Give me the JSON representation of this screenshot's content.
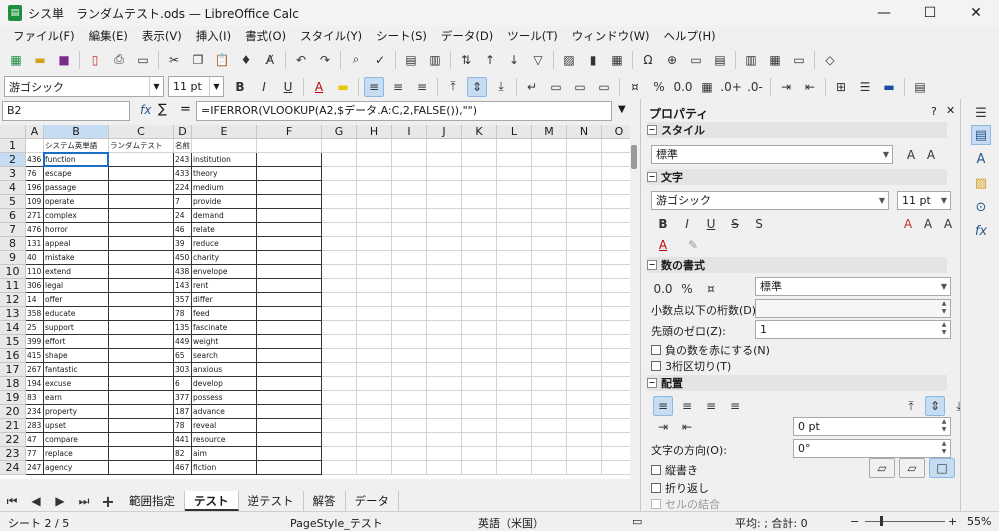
{
  "window": {
    "title": "シス単　ランダムテスト.ods — LibreOffice Calc",
    "app_icon": "calc-icon"
  },
  "menu": [
    "ファイル(F)",
    "編集(E)",
    "表示(V)",
    "挿入(I)",
    "書式(O)",
    "スタイル(Y)",
    "シート(S)",
    "データ(D)",
    "ツール(T)",
    "ウィンドウ(W)",
    "ヘルプ(H)"
  ],
  "format": {
    "font": "游ゴシック",
    "size": "11 pt"
  },
  "formula_bar": {
    "cell": "B2",
    "formula": "=IFERROR(VLOOKUP(A2,$データ.A:C,2,FALSE()),\"\")",
    "fx": "fx",
    "sigma": "∑",
    "eq": "="
  },
  "columns": [
    "A",
    "B",
    "C",
    "D",
    "E",
    "F",
    "G",
    "H",
    "I",
    "J",
    "K",
    "L",
    "M",
    "N",
    "O"
  ],
  "header_row": {
    "b": "システム英単語",
    "c": "ランダムテスト",
    "d": "名前："
  },
  "rows": [
    {
      "n": "2",
      "a": "436",
      "b": "function",
      "d": "243",
      "e": "institution"
    },
    {
      "n": "3",
      "a": "76",
      "b": "escape",
      "d": "433",
      "e": "theory"
    },
    {
      "n": "4",
      "a": "196",
      "b": "passage",
      "d": "224",
      "e": "medium"
    },
    {
      "n": "5",
      "a": "109",
      "b": "operate",
      "d": "7",
      "e": "provide"
    },
    {
      "n": "6",
      "a": "271",
      "b": "complex",
      "d": "24",
      "e": "demand"
    },
    {
      "n": "7",
      "a": "476",
      "b": "horror",
      "d": "46",
      "e": "relate"
    },
    {
      "n": "8",
      "a": "131",
      "b": "appeal",
      "d": "39",
      "e": "reduce"
    },
    {
      "n": "9",
      "a": "40",
      "b": "mistake",
      "d": "450",
      "e": "charity"
    },
    {
      "n": "10",
      "a": "110",
      "b": "extend",
      "d": "438",
      "e": "envelope"
    },
    {
      "n": "11",
      "a": "306",
      "b": "legal",
      "d": "143",
      "e": "rent"
    },
    {
      "n": "12",
      "a": "14",
      "b": "offer",
      "d": "357",
      "e": "differ"
    },
    {
      "n": "13",
      "a": "358",
      "b": "educate",
      "d": "78",
      "e": "feed"
    },
    {
      "n": "14",
      "a": "25",
      "b": "support",
      "d": "135",
      "e": "fascinate"
    },
    {
      "n": "15",
      "a": "399",
      "b": "effort",
      "d": "449",
      "e": "weight"
    },
    {
      "n": "16",
      "a": "415",
      "b": "shape",
      "d": "65",
      "e": "search"
    },
    {
      "n": "17",
      "a": "267",
      "b": "fantastic",
      "d": "303",
      "e": "anxious"
    },
    {
      "n": "18",
      "a": "194",
      "b": "excuse",
      "d": "6",
      "e": "develop"
    },
    {
      "n": "19",
      "a": "83",
      "b": "earn",
      "d": "377",
      "e": "possess"
    },
    {
      "n": "20",
      "a": "234",
      "b": "property",
      "d": "187",
      "e": "advance"
    },
    {
      "n": "21",
      "a": "283",
      "b": "upset",
      "d": "78",
      "e": "reveal"
    },
    {
      "n": "22",
      "a": "47",
      "b": "compare",
      "d": "441",
      "e": "resource"
    },
    {
      "n": "23",
      "a": "77",
      "b": "replace",
      "d": "82",
      "e": "aim"
    },
    {
      "n": "24",
      "a": "247",
      "b": "agency",
      "d": "467",
      "e": "fiction"
    }
  ],
  "tabs": [
    "範囲指定",
    "テスト",
    "逆テスト",
    "解答",
    "データ"
  ],
  "active_tab": "テスト",
  "status": {
    "sheet": "シート 2 / 5",
    "page_style": "PageStyle_テスト",
    "lang": "英語（米国）",
    "sum": "平均: ; 合計: 0",
    "zoom": "55%"
  },
  "sidebar": {
    "title": "プロパティ",
    "style": {
      "header": "スタイル",
      "value": "標準"
    },
    "char": {
      "header": "文字",
      "font": "游ゴシック",
      "size": "11 pt"
    },
    "numfmt": {
      "header": "数の書式",
      "category": "標準",
      "decimals_label": "小数点以下の桁数(D):",
      "leading_label": "先頭のゼロ(Z):",
      "leading_value": "1",
      "negative_red": "負の数を赤にする(N)",
      "thousands": "3桁区切り(T)"
    },
    "align": {
      "header": "配置",
      "indent_value": "0 pt",
      "direction_label": "文字の方向(O):",
      "direction_value": "0°",
      "vertical": "縦書き",
      "wrap": "折り返し",
      "merge": "セルの結合"
    }
  }
}
